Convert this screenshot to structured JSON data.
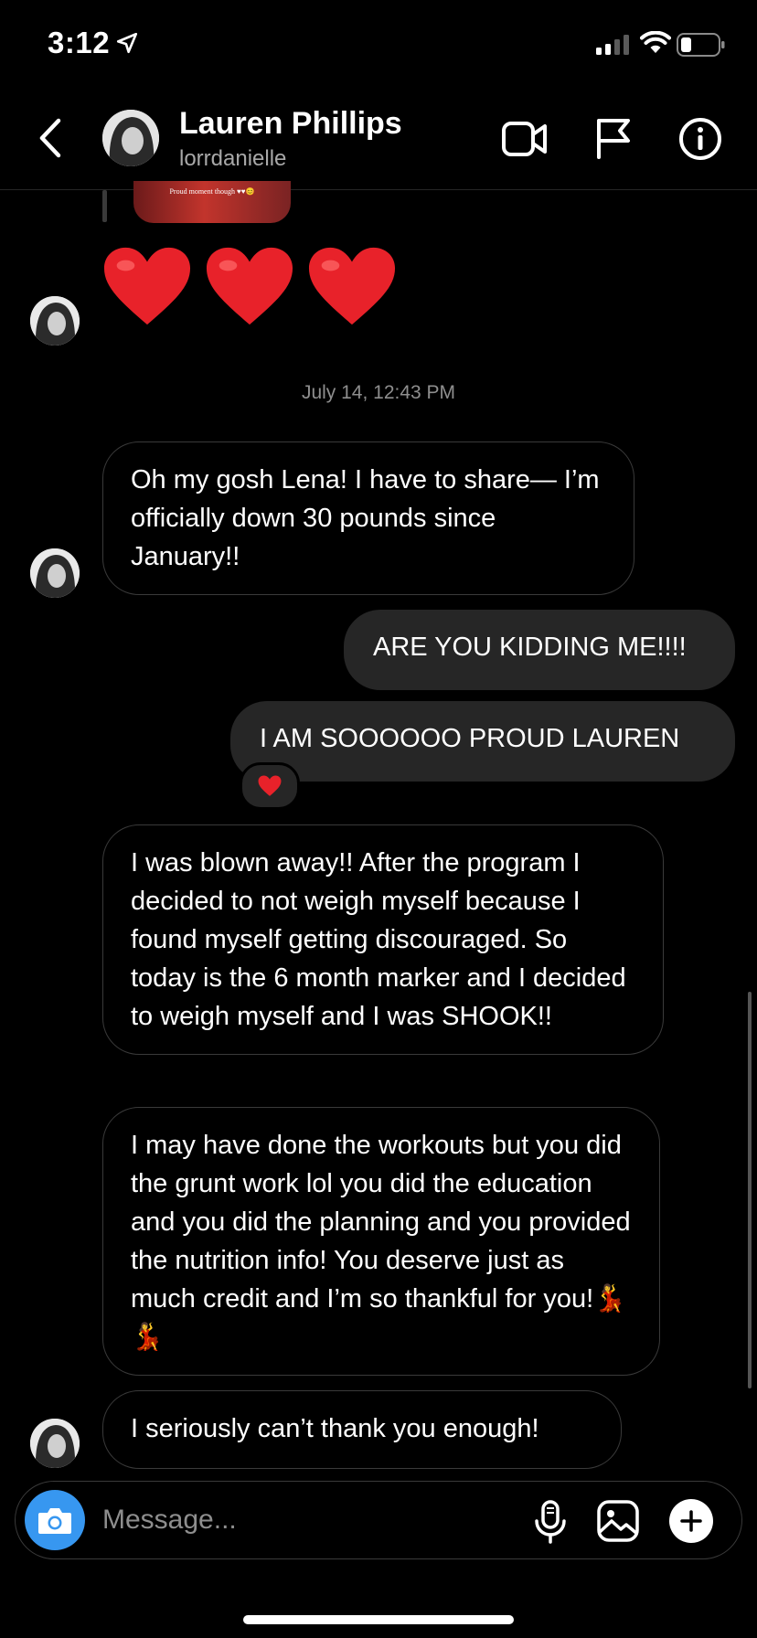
{
  "status_bar": {
    "time": "3:12",
    "icons": [
      "location-arrow-icon",
      "signal-icon",
      "wifi-icon",
      "battery-icon"
    ]
  },
  "header": {
    "name": "Lauren Phillips",
    "username": "lorrdanielle",
    "icons": [
      "back-icon",
      "video-call-icon",
      "flag-icon",
      "info-icon"
    ]
  },
  "thread": {
    "story_reply_caption": "Proud moment though ♥♥😊",
    "hearts": [
      "❤️",
      "❤️",
      "❤️"
    ],
    "timestamp": "July 14, 12:43 PM",
    "messages": [
      {
        "from": "them",
        "text": "Oh my gosh Lena! I have to share— I’m officially down 30 pounds since January!!"
      },
      {
        "from": "me",
        "text": "ARE YOU KIDDING ME!!!!"
      },
      {
        "from": "me",
        "text": "I AM SOOOOOO PROUD LAUREN",
        "reaction": "❤️"
      },
      {
        "from": "them",
        "text": "I was blown away!! After the program I decided to not weigh myself because I found myself getting discouraged. So today is the 6 month marker and I decided to weigh myself and I was SHOOK!!"
      },
      {
        "from": "them",
        "text": "I may have done the workouts but you did the grunt work lol you did the education and you did the planning and you provided the nutrition info! You deserve just as much credit and I’m so thankful for you!💃💃"
      },
      {
        "from": "them",
        "text": "I seriously can’t thank you enough!"
      }
    ]
  },
  "composer": {
    "placeholder": "Message...",
    "icons": [
      "camera-icon",
      "microphone-icon",
      "gallery-icon",
      "plus-icon"
    ]
  },
  "colors": {
    "background": "#000000",
    "outgoing_bubble": "#262626",
    "incoming_border": "#3a3a3a",
    "accent": "#3797f0",
    "muted_text": "#8e8e8e"
  }
}
